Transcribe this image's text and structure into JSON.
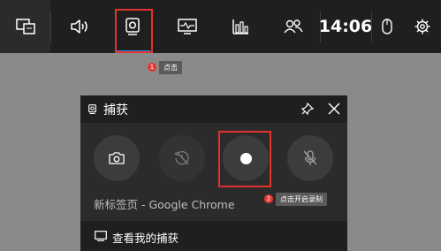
{
  "topbar": {
    "icons": [
      "widget-menu-icon",
      "audio-icon",
      "capture-icon",
      "performance-icon",
      "resources-icon",
      "social-icon",
      "mouse-icon",
      "settings-icon"
    ],
    "time": "14:06",
    "accent_color": "#1f8fff",
    "highlight_color": "#e2322b"
  },
  "callouts": [
    {
      "number": "1",
      "label": "点击"
    },
    {
      "number": "2",
      "label": "点击开启录制"
    }
  ],
  "capture_panel": {
    "title": "捕获",
    "buttons": [
      "screenshot",
      "record-last",
      "start-recording",
      "mic-off"
    ],
    "window_name": "新标签页 - Google Chrome",
    "footer_label": "查看我的捕获"
  }
}
